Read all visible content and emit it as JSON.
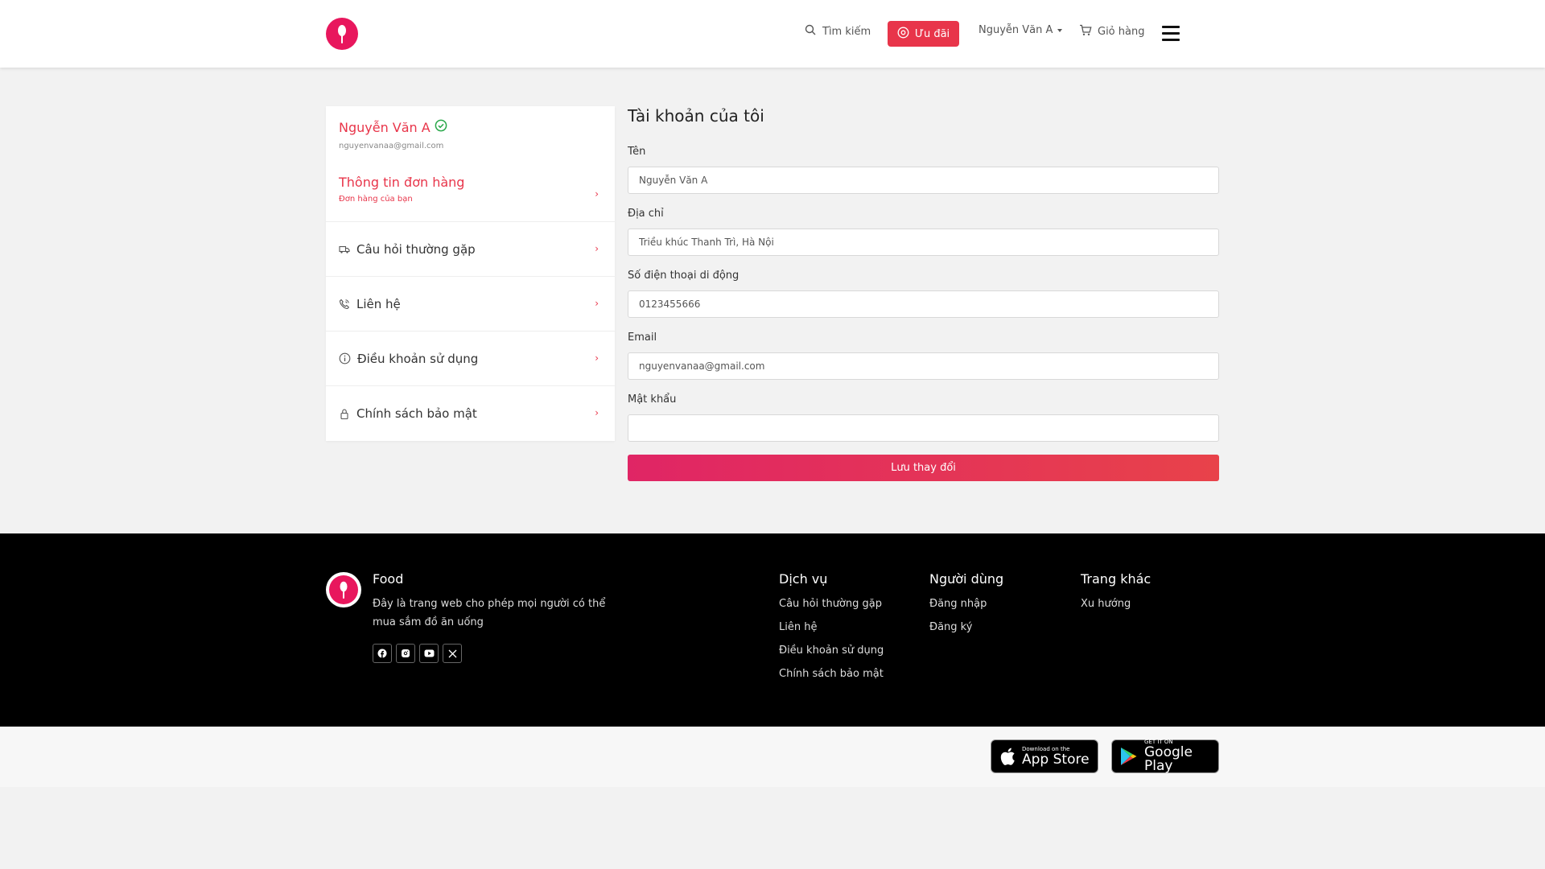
{
  "header": {
    "search_label": "Tìm kiếm",
    "promo_label": "Ưu đãi",
    "user_label": "Nguyễn Văn A",
    "cart_label": "Giỏ hàng"
  },
  "sidebar": {
    "profile": {
      "name": "Nguyễn Văn A",
      "email": "nguyenvanaa@gmail.com"
    },
    "orders": {
      "title": "Thông tin đơn hàng",
      "subtitle": "Đơn hàng của bạn"
    },
    "items": [
      {
        "label": "Câu hỏi thường gặp",
        "icon": "truck-icon"
      },
      {
        "label": "Liên hệ",
        "icon": "phone-icon"
      },
      {
        "label": "Điều khoản sử dụng",
        "icon": "info-icon"
      },
      {
        "label": "Chính sách bảo mật",
        "icon": "lock-icon"
      }
    ]
  },
  "form": {
    "title": "Tài khoản của tôi",
    "fields": [
      {
        "label": "Tên",
        "value": "Nguyễn Văn A"
      },
      {
        "label": "Địa chỉ",
        "value": "Triều khúc Thanh Trì, Hà Nội"
      },
      {
        "label": "Số điện thoại di động",
        "value": "0123455666"
      },
      {
        "label": "Email",
        "value": "nguyenvanaa@gmail.com"
      },
      {
        "label": "Mật khẩu",
        "value": ""
      }
    ],
    "save_label": "Lưu thay đổi"
  },
  "footer": {
    "brand": "Food",
    "description": "Đây là trang web cho phép mọi người có thể mua sắm đồ ăn uống",
    "columns": [
      {
        "title": "Dịch vụ",
        "links": [
          "Câu hỏi thường gặp",
          "Liên hệ",
          "Điều khoản sử dụng",
          "Chính sách bảo mật"
        ]
      },
      {
        "title": "Người dùng",
        "links": [
          "Đăng nhập",
          "Đăng ký"
        ]
      },
      {
        "title": "Trang khác",
        "links": [
          "Xu hướng"
        ]
      }
    ]
  },
  "apps": {
    "appstore_small": "Download on the",
    "appstore_big": "App Store",
    "googleplay_small": "GET IT ON",
    "googleplay_big": "Google Play"
  },
  "colors": {
    "brand": "#e8175d",
    "accent": "#e8354a",
    "verified": "#2aa84a",
    "footer_bg": "#000000"
  }
}
